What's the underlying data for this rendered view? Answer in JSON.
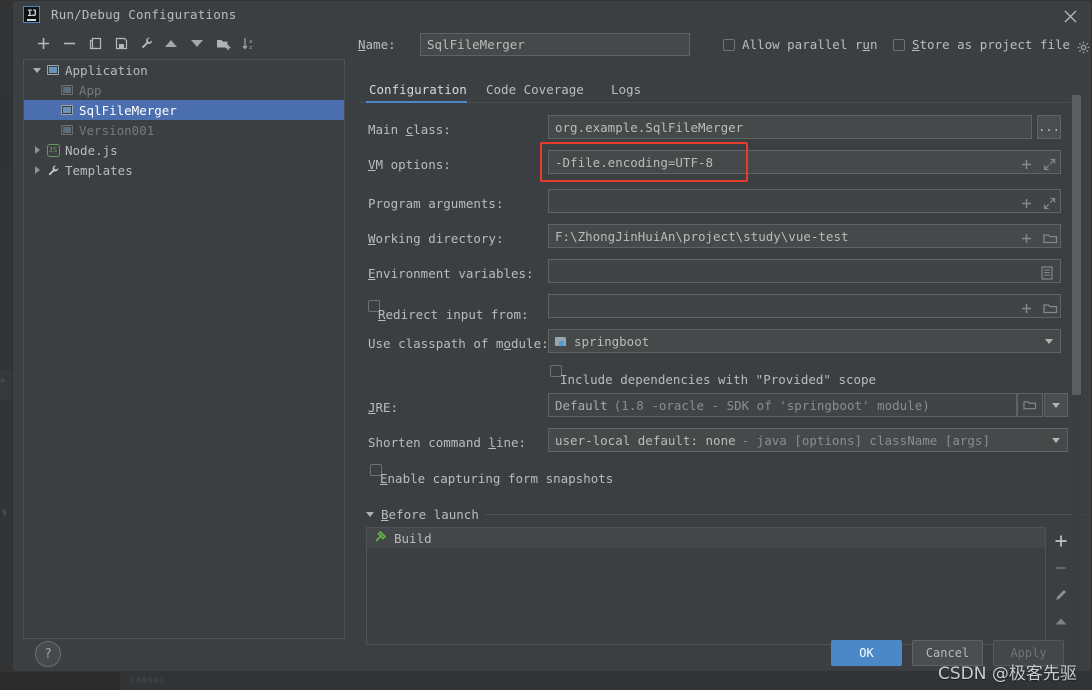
{
  "window": {
    "title": "Run/Debug Configurations",
    "logo_text": "IJ",
    "close_icon": "close-icon"
  },
  "sidebar": {
    "toolbar": [
      {
        "name": "add-configuration-button",
        "icon": "plus-icon"
      },
      {
        "name": "remove-configuration-button",
        "icon": "minus-icon"
      },
      {
        "name": "copy-configuration-button",
        "icon": "copy-icon"
      },
      {
        "name": "save-configuration-button",
        "icon": "save-icon"
      },
      {
        "name": "edit-templates-button",
        "icon": "wrench-icon"
      },
      {
        "name": "move-up-button",
        "icon": "arrow-up-icon"
      },
      {
        "name": "move-down-button",
        "icon": "arrow-down-icon"
      },
      {
        "name": "new-folder-button",
        "icon": "folder-plus-icon"
      },
      {
        "name": "sort-configurations-button",
        "icon": "sort-az-icon"
      }
    ],
    "tree": [
      {
        "label": "Application",
        "level": 0,
        "expanded": true,
        "icon": "application-icon",
        "selected": false,
        "dim": false
      },
      {
        "label": "App",
        "level": 1,
        "expanded": null,
        "icon": "application-icon",
        "selected": false,
        "dim": true
      },
      {
        "label": "SqlFileMerger",
        "level": 1,
        "expanded": null,
        "icon": "application-icon",
        "selected": true,
        "dim": false
      },
      {
        "label": "Version001",
        "level": 1,
        "expanded": null,
        "icon": "application-icon",
        "selected": false,
        "dim": true
      },
      {
        "label": "Node.js",
        "level": 0,
        "expanded": false,
        "icon": "nodejs-icon",
        "selected": false,
        "dim": false
      },
      {
        "label": "Templates",
        "level": 0,
        "expanded": false,
        "icon": "wrench-icon",
        "selected": false,
        "dim": false
      }
    ]
  },
  "header": {
    "name_label": "Name:",
    "name_value": "SqlFileMerger",
    "allow_parallel_run_label": "Allow parallel run",
    "allow_parallel_run_checked": false,
    "store_as_project_file_label": "Store as project file",
    "store_as_project_file_checked": false,
    "gear_icon": "gear-icon"
  },
  "tabs": [
    {
      "label": "Configuration",
      "active": true
    },
    {
      "label": "Code Coverage",
      "active": false
    },
    {
      "label": "Logs",
      "active": false
    }
  ],
  "form": {
    "main_class": {
      "label": "Main class:",
      "value": "org.example.SqlFileMerger",
      "browse_label": "..."
    },
    "vm_options": {
      "label": "VM options:",
      "value": "-Dfile.encoding=UTF-8",
      "highlighted": true
    },
    "program_arguments": {
      "label": "Program arguments:",
      "value": ""
    },
    "working_directory": {
      "label": "Working directory:",
      "value": "F:\\ZhongJinHuiAn\\project\\study\\vue-test"
    },
    "environment_variables": {
      "label": "Environment variables:",
      "value": ""
    },
    "redirect_input_from": {
      "label": "Redirect input from:",
      "value": "",
      "checked": false
    },
    "use_classpath_of_module": {
      "label": "Use classpath of module:",
      "value": "springboot"
    },
    "include_provided_scope": {
      "label": "Include dependencies with \"Provided\" scope",
      "checked": false
    },
    "jre": {
      "label": "JRE:",
      "value": "Default",
      "hint": "(1.8 -oracle - SDK of 'springboot' module)"
    },
    "shorten_command_line": {
      "label": "Shorten command line:",
      "value": "user-local default: none",
      "hint": "- java [options] className [args]"
    },
    "enable_form_snapshots": {
      "label": "Enable capturing form snapshots",
      "checked": false
    }
  },
  "before_launch": {
    "title": "Before launch",
    "expanded": true,
    "items": [
      {
        "label": "Build",
        "icon": "hammer-icon"
      }
    ],
    "buttons": [
      {
        "name": "add-task-button",
        "icon": "plus-icon"
      },
      {
        "name": "remove-task-button",
        "icon": "minus-icon"
      },
      {
        "name": "edit-task-button",
        "icon": "pencil-icon"
      },
      {
        "name": "move-task-up-button",
        "icon": "arrow-up-icon"
      }
    ]
  },
  "footer": {
    "help_label": "?",
    "ok_label": "OK",
    "cancel_label": "Cancel",
    "apply_label": "Apply",
    "apply_disabled": true
  },
  "watermark": "CSDN @极客先驱",
  "colors": {
    "accent": "#4a88c7",
    "selection": "#4b6eaf",
    "annotation": "#e83b2e",
    "panel_bg": "#3c3f41",
    "field_bg": "#45494a",
    "text": "#bbbbbb"
  }
}
